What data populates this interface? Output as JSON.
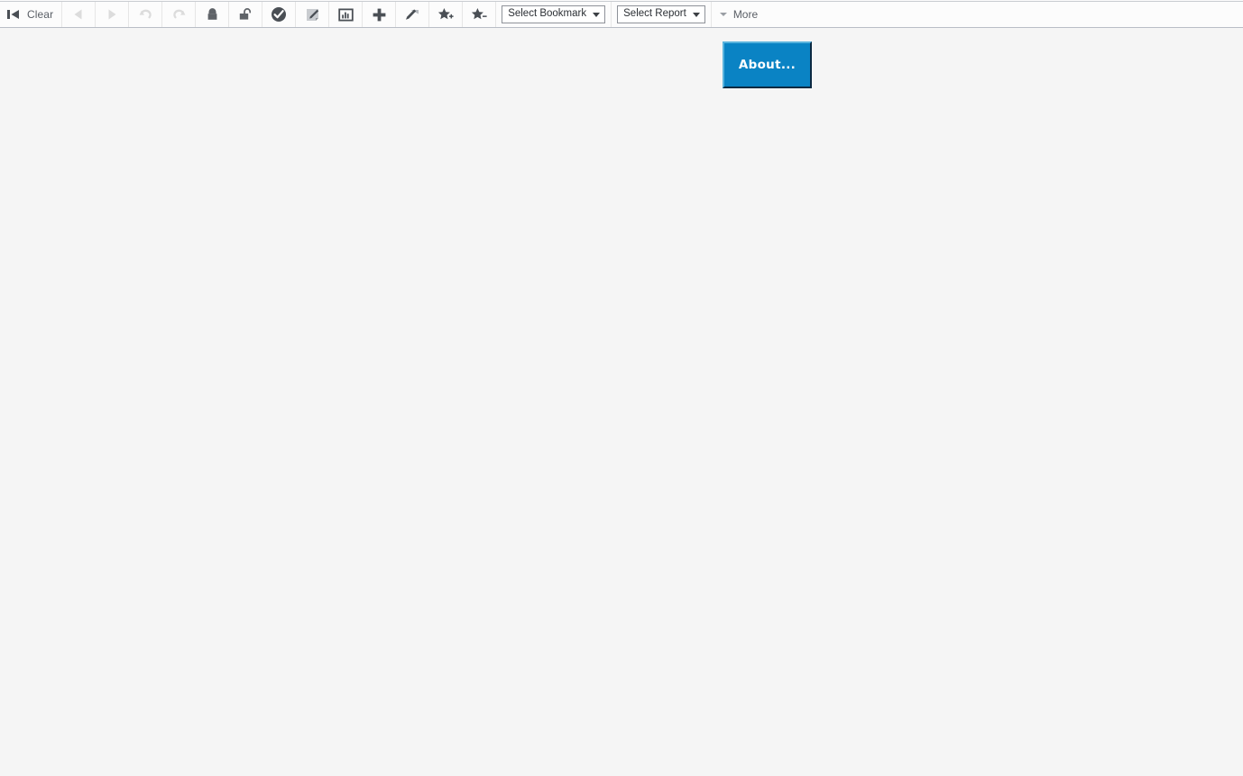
{
  "toolbar": {
    "clear": {
      "label": "Clear",
      "icon": "back-to-start-icon"
    },
    "buttons": [
      {
        "name": "back-button",
        "icon": "triangle-left-icon",
        "state": "disabled"
      },
      {
        "name": "forward-button",
        "icon": "triangle-right-icon",
        "state": "disabled"
      },
      {
        "name": "undo-button",
        "icon": "undo-arrow-icon",
        "state": "disabled"
      },
      {
        "name": "redo-button",
        "icon": "redo-arrow-icon",
        "state": "disabled"
      },
      {
        "name": "lock-button",
        "icon": "lock-closed-icon",
        "state": "enabled"
      },
      {
        "name": "unlock-button",
        "icon": "lock-open-icon",
        "state": "enabled"
      },
      {
        "name": "current-selections-button",
        "icon": "check-circle-icon",
        "state": "enabled"
      },
      {
        "name": "edit-button",
        "icon": "pencil-page-icon",
        "state": "enabled"
      },
      {
        "name": "chart-button",
        "icon": "bar-chart-box-icon",
        "state": "enabled"
      },
      {
        "name": "add-button",
        "icon": "plus-icon",
        "state": "enabled"
      },
      {
        "name": "design-tool-button",
        "icon": "pen-tool-icon",
        "state": "enabled"
      },
      {
        "name": "add-bookmark-button",
        "icon": "star-plus-icon",
        "state": "enabled"
      },
      {
        "name": "remove-bookmark-button",
        "icon": "star-minus-icon",
        "state": "enabled"
      }
    ],
    "bookmark_select": {
      "label": "Select Bookmark"
    },
    "report_select": {
      "label": "Select Report"
    },
    "more": {
      "label": "More"
    }
  },
  "canvas": {
    "about_button": {
      "label": "About..."
    }
  },
  "colors": {
    "accent_blue": "#0a83c4",
    "accent_blue_highlight": "#59b3dd",
    "accent_blue_shadow": "#0c2a42",
    "toolbar_bg": "#fcfcfc",
    "canvas_bg": "#f5f5f5",
    "icon_gray": "#5f6368",
    "icon_disabled": "#dcdcdc"
  }
}
